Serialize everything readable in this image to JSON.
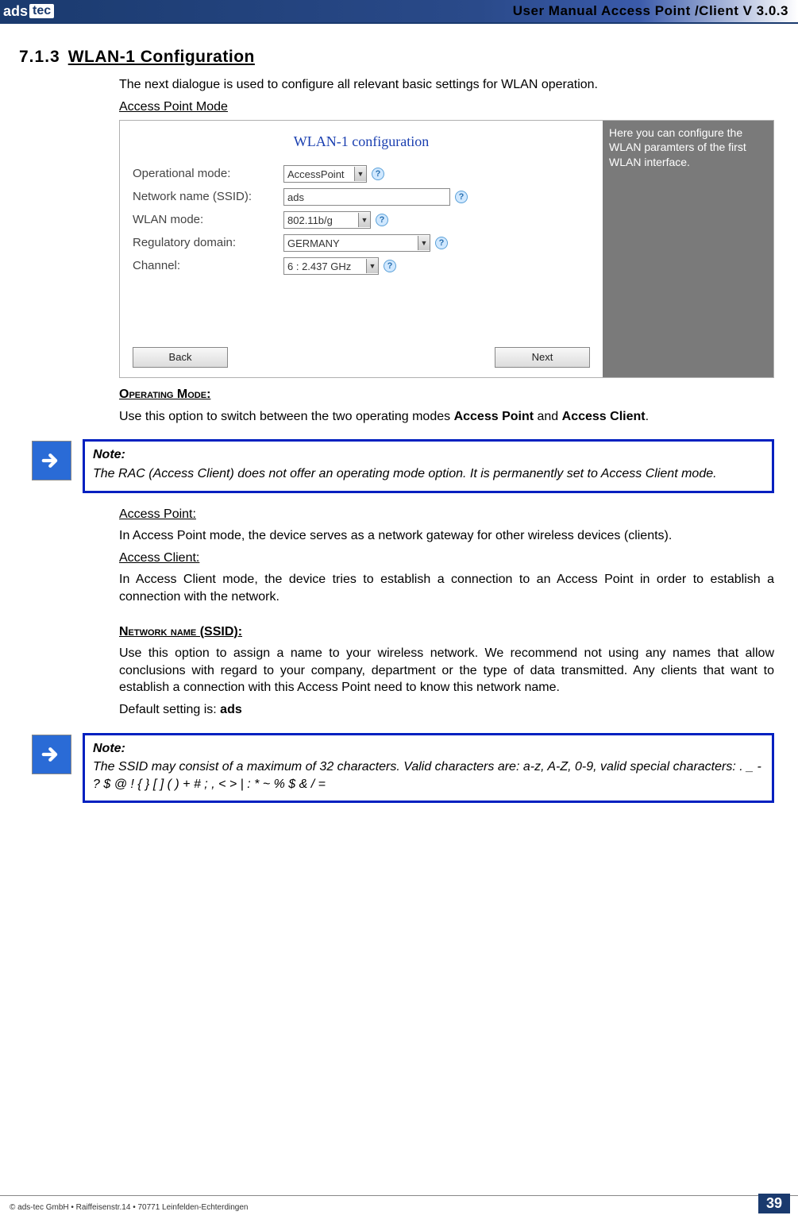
{
  "header": {
    "logo_main": "ads",
    "logo_suffix": "tec",
    "manual_title": "User Manual Access  Point /Client V 3.0.3"
  },
  "section": {
    "number": "7.1.3",
    "title": "WLAN-1 Configuration"
  },
  "intro": "The next dialogue is used to configure all relevant basic settings for WLAN operation.",
  "mode_label": "Access Point Mode",
  "screenshot": {
    "title": "WLAN-1 configuration",
    "rows": {
      "op_mode_label": "Operational mode:",
      "op_mode_value": "AccessPoint",
      "ssid_label": "Network name (SSID):",
      "ssid_value": "ads",
      "wlan_mode_label": "WLAN mode:",
      "wlan_mode_value": "802.11b/g",
      "reg_label": "Regulatory domain:",
      "reg_value": "GERMANY",
      "channel_label": "Channel:",
      "channel_value": "6 : 2.437 GHz"
    },
    "back": "Back",
    "next": "Next",
    "side": "Here you can configure the WLAN paramters of the first WLAN interface."
  },
  "op_mode": {
    "heading": "Operating Mode:",
    "text_pre": "Use this option to switch between the two operating modes ",
    "text_b1": "Access Point",
    "text_mid": " and ",
    "text_b2": "Access Client",
    "text_post": "."
  },
  "note1": {
    "label": "Note:",
    "text": "The RAC (Access Client) does not offer an operating mode option. It is permanently set to Access Client mode."
  },
  "ap": {
    "heading": "Access Point:",
    "text": "In Access Point mode, the device serves as a network gateway for other wireless devices (clients)."
  },
  "ac": {
    "heading": "Access Client:",
    "text": "In Access Client mode, the device tries to establish a connection to an Access Point in order to establish a connection with the network."
  },
  "ssid": {
    "heading": "Network name (SSID):",
    "text": "Use this option to assign a name to your wireless network. We recommend not using any names that allow conclusions with regard to your company, department or the type of data transmitted. Any clients that want to establish a connection with this Access Point need to know this network name.",
    "default_pre": "Default setting is: ",
    "default_val": "ads"
  },
  "note2": {
    "label": "Note:",
    "text": "The SSID may consist of a maximum of 32 characters. Valid characters are: a-z, A-Z, 0-9, valid special characters: . _ - ? $ @ ! { } [ ] ( ) + # ; , < > | : * ~ % $ & / ="
  },
  "footer": {
    "text": "© ads-tec GmbH • Raiffeisenstr.14 • 70771 Leinfelden-Echterdingen",
    "page": "39"
  }
}
